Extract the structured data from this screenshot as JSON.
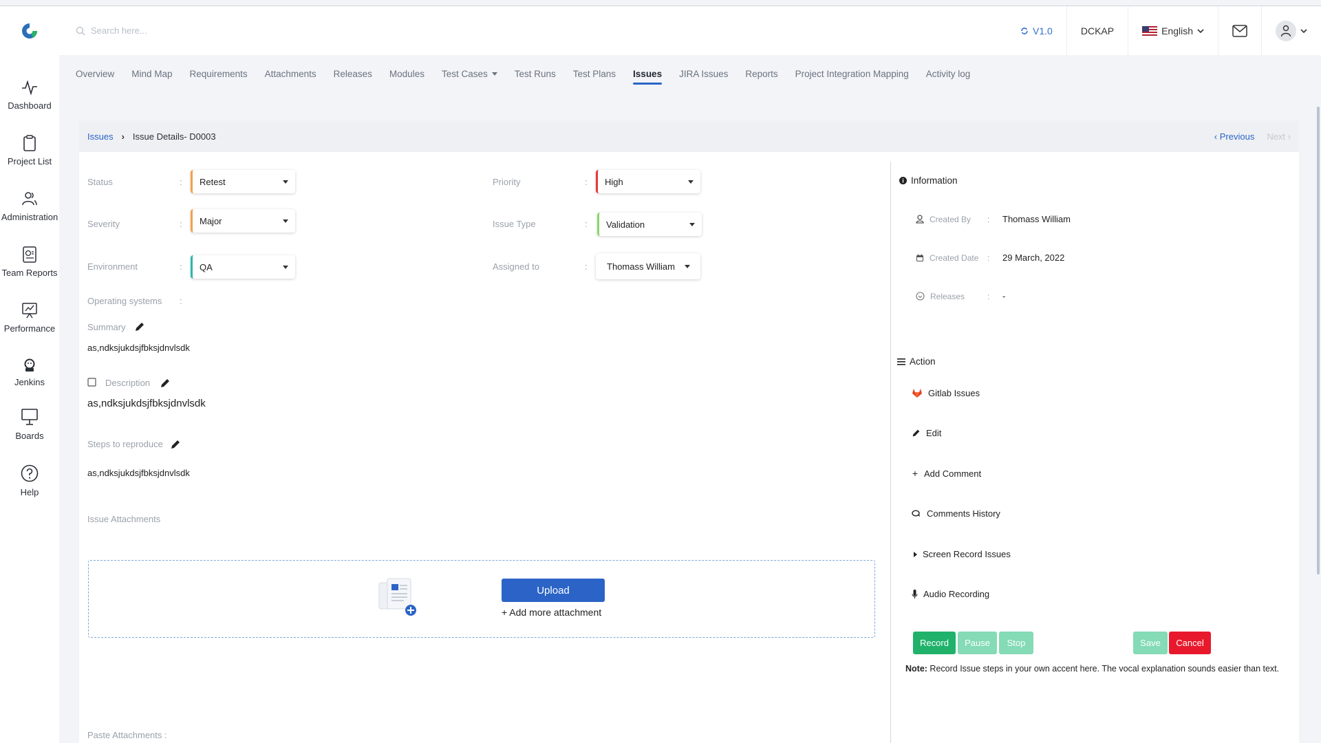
{
  "topbar": {
    "search_placeholder": "Search here...",
    "version": "V1.0",
    "org": "DCKAP",
    "language": "English"
  },
  "sidebar": {
    "items": [
      {
        "label": "Dashboard",
        "icon": "activity-icon"
      },
      {
        "label": "Project List",
        "icon": "clipboard-icon"
      },
      {
        "label": "Administration",
        "icon": "users-icon"
      },
      {
        "label": "Team Reports",
        "icon": "report-icon"
      },
      {
        "label": "Performance",
        "icon": "performance-icon"
      },
      {
        "label": "Jenkins",
        "icon": "jenkins-icon"
      },
      {
        "label": "Boards",
        "icon": "board-icon"
      },
      {
        "label": "Help",
        "icon": "help-icon"
      }
    ]
  },
  "tabs": [
    {
      "label": "Overview"
    },
    {
      "label": "Mind Map"
    },
    {
      "label": "Requirements"
    },
    {
      "label": "Attachments"
    },
    {
      "label": "Releases"
    },
    {
      "label": "Modules"
    },
    {
      "label": "Test Cases"
    },
    {
      "label": "Test Runs"
    },
    {
      "label": "Test Plans"
    },
    {
      "label": "Issues"
    },
    {
      "label": "JIRA Issues"
    },
    {
      "label": "Reports"
    },
    {
      "label": "Project Integration Mapping"
    },
    {
      "label": "Activity log"
    }
  ],
  "breadcrumb": {
    "root": "Issues",
    "current": "Issue Details- D0003",
    "previous": "Previous",
    "next": "Next"
  },
  "fields": {
    "status_label": "Status",
    "status_value": "Retest",
    "severity_label": "Severity",
    "severity_value": "Major",
    "environment_label": "Environment",
    "environment_value": "QA",
    "priority_label": "Priority",
    "priority_value": "High",
    "issue_type_label": "Issue Type",
    "issue_type_value": "Validation",
    "assigned_label": "Assigned to",
    "assigned_value": "Thomass William",
    "os_label": "Operating systems",
    "colon": ":"
  },
  "summary": {
    "label": "Summary",
    "value": "as,ndksjukdsjfbksjdnvlsdk"
  },
  "description": {
    "label": "Description",
    "value": "as,ndksjukdsjfbksjdnvlsdk"
  },
  "steps": {
    "label": "Steps to reproduce",
    "value": "as,ndksjukdsjfbksjdnvlsdk"
  },
  "attachments": {
    "label": "Issue Attachments",
    "upload": "Upload",
    "add_more": "+ Add more attachment",
    "paste_label": "Paste Attachments :"
  },
  "information": {
    "title": "Information",
    "created_by_label": "Created By",
    "created_by": "Thomass William",
    "created_date_label": "Created Date",
    "created_date": "29 March, 2022",
    "releases_label": "Releases",
    "releases": "-"
  },
  "action": {
    "title": "Action",
    "items": [
      "Gitlab Issues",
      "Edit",
      "Add Comment",
      "Comments History",
      "Screen Record Issues",
      "Audio Recording"
    ]
  },
  "recording": {
    "record": "Record",
    "pause": "Pause",
    "stop": "Stop",
    "save": "Save",
    "cancel": "Cancel",
    "note_bold": "Note:",
    "note_text": " Record Issue steps in your own accent here. The vocal explanation sounds easier than text."
  },
  "colors": {
    "accent": "#2b64c6",
    "record_green": "#20b26b",
    "cancel_red": "#e8192c"
  }
}
